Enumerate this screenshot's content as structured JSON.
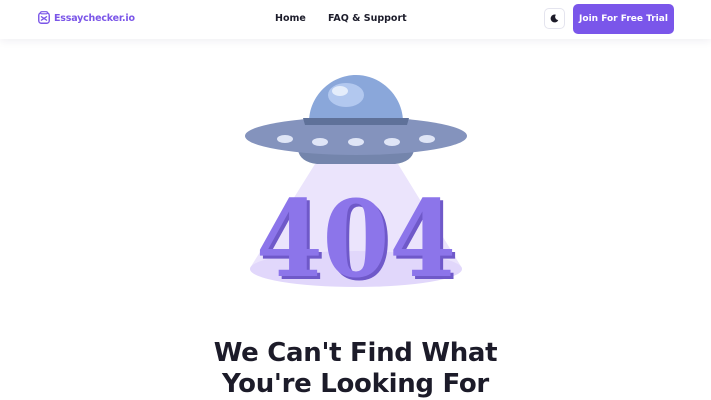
{
  "header": {
    "logo_text": "Essaychecker.io",
    "nav": {
      "home_label": "Home",
      "faq_label": "FAQ & Support"
    },
    "theme_toggle_icon": "moon-icon",
    "cta_label": "Join For Free Trial"
  },
  "illustration": {
    "icon": "ufo-illustration",
    "error_code": "404"
  },
  "main": {
    "headline_line1": "We Can't Find What",
    "headline_line2": "You're Looking For"
  },
  "colors": {
    "brand_purple": "#7a56ea",
    "text_dark": "#1c1b29",
    "beam_light": "#ebe4fc",
    "digits": "#8c75ea",
    "ufo_body": "#7f8db8"
  }
}
